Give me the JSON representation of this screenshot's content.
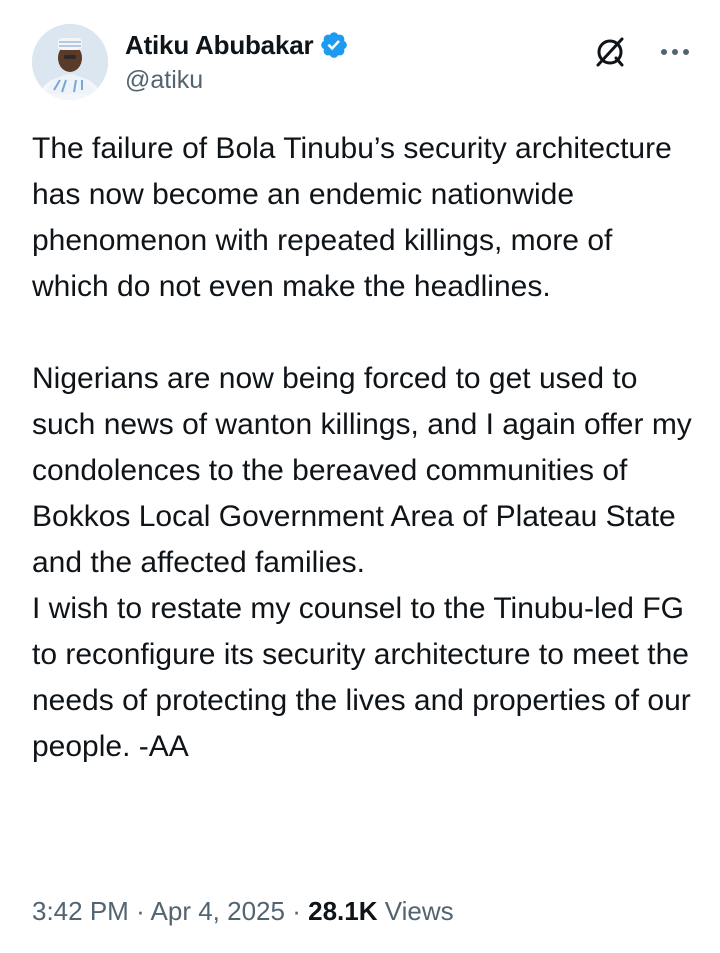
{
  "author": {
    "display_name": "Atiku Abubakar",
    "handle": "@atiku",
    "verified": true,
    "verified_color": "#1d9bf0"
  },
  "actions": {
    "grok_icon": "grok-icon",
    "more_icon": "more-icon"
  },
  "tweet": {
    "paragraphs": [
      "The failure of Bola Tinubu’s security architecture has now become an endemic nationwide phenomenon with repeated killings, more of which do not even make the headlines.",
      "Nigerians are now being forced to get used to such news of wanton killings, and I again offer my condolences to the bereaved communities of Bokkos Local Government Area of Plateau State and the affected families.",
      "I wish to restate my counsel to the Tinubu-led FG to reconfigure its security architecture to meet the needs of protecting the lives and properties of our people. -AA"
    ]
  },
  "meta": {
    "time": "3:42 PM",
    "separator": "·",
    "date": "Apr 4, 2025",
    "views_count": "28.1K",
    "views_label": "Views"
  }
}
